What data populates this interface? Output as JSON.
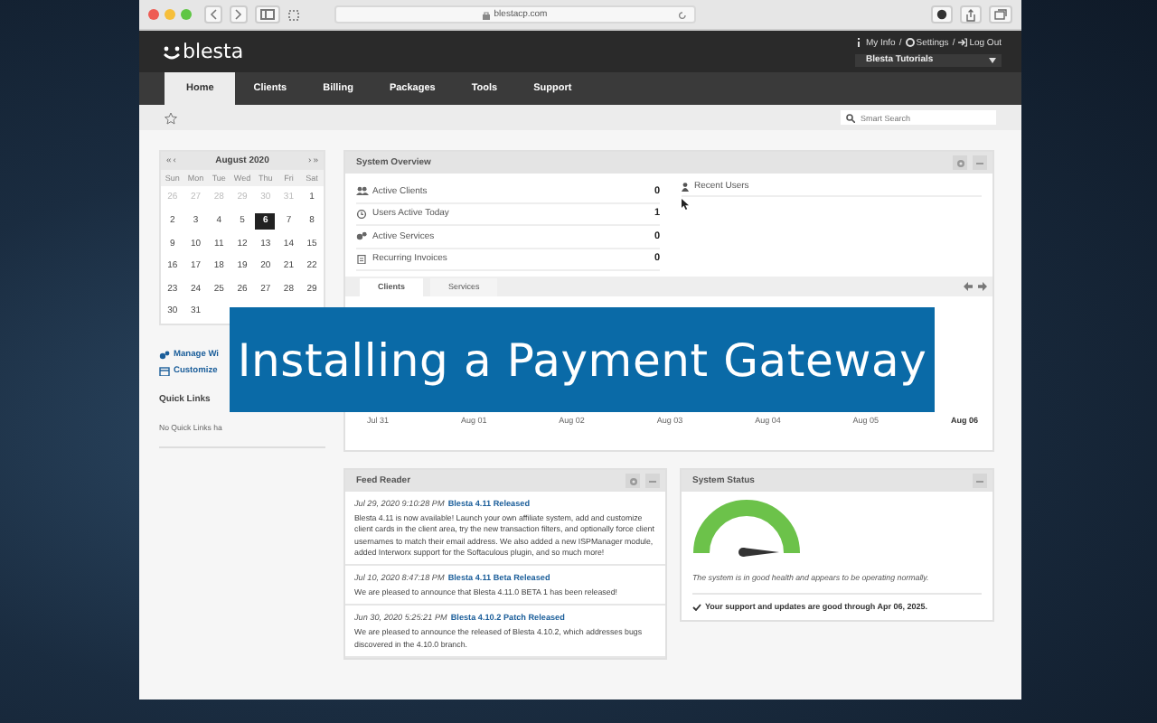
{
  "browser": {
    "url": "blestacp.com"
  },
  "header": {
    "logo": "blesta",
    "user_links": [
      "My Info",
      "Settings",
      "Log Out"
    ],
    "separator": "/",
    "company": "Blesta Tutorials"
  },
  "nav": [
    {
      "label": "Home",
      "selected": true
    },
    {
      "label": "Clients",
      "selected": false
    },
    {
      "label": "Billing",
      "selected": false
    },
    {
      "label": "Packages",
      "selected": false
    },
    {
      "label": "Tools",
      "selected": false
    },
    {
      "label": "Support",
      "selected": false
    }
  ],
  "search": {
    "placeholder": "Smart Search"
  },
  "calendar": {
    "title": "August 2020",
    "prev_year": "«",
    "prev": "‹",
    "next": "›",
    "next_year": "»",
    "weekdays": [
      "Sun",
      "Mon",
      "Tue",
      "Wed",
      "Thu",
      "Fri",
      "Sat"
    ],
    "weeks": [
      [
        {
          "day": "26",
          "muted": true,
          "selected": false
        },
        {
          "day": "27",
          "muted": true,
          "selected": false
        },
        {
          "day": "28",
          "muted": true,
          "selected": false
        },
        {
          "day": "29",
          "muted": true,
          "selected": false
        },
        {
          "day": "30",
          "muted": true,
          "selected": false
        },
        {
          "day": "31",
          "muted": true,
          "selected": false
        },
        {
          "day": "1",
          "muted": false,
          "selected": false
        }
      ],
      [
        {
          "day": "2",
          "muted": false,
          "selected": false
        },
        {
          "day": "3",
          "muted": false,
          "selected": false
        },
        {
          "day": "4",
          "muted": false,
          "selected": false
        },
        {
          "day": "5",
          "muted": false,
          "selected": false
        },
        {
          "day": "6",
          "muted": false,
          "selected": true
        },
        {
          "day": "7",
          "muted": false,
          "selected": false
        },
        {
          "day": "8",
          "muted": false,
          "selected": false
        }
      ],
      [
        {
          "day": "9",
          "muted": false,
          "selected": false
        },
        {
          "day": "10",
          "muted": false,
          "selected": false
        },
        {
          "day": "11",
          "muted": false,
          "selected": false
        },
        {
          "day": "12",
          "muted": false,
          "selected": false
        },
        {
          "day": "13",
          "muted": false,
          "selected": false
        },
        {
          "day": "14",
          "muted": false,
          "selected": false
        },
        {
          "day": "15",
          "muted": false,
          "selected": false
        }
      ],
      [
        {
          "day": "16",
          "muted": false,
          "selected": false
        },
        {
          "day": "17",
          "muted": false,
          "selected": false
        },
        {
          "day": "18",
          "muted": false,
          "selected": false
        },
        {
          "day": "19",
          "muted": false,
          "selected": false
        },
        {
          "day": "20",
          "muted": false,
          "selected": false
        },
        {
          "day": "21",
          "muted": false,
          "selected": false
        },
        {
          "day": "22",
          "muted": false,
          "selected": false
        }
      ],
      [
        {
          "day": "23",
          "muted": false,
          "selected": false
        },
        {
          "day": "24",
          "muted": false,
          "selected": false
        },
        {
          "day": "25",
          "muted": false,
          "selected": false
        },
        {
          "day": "26",
          "muted": false,
          "selected": false
        },
        {
          "day": "27",
          "muted": false,
          "selected": false
        },
        {
          "day": "28",
          "muted": false,
          "selected": false
        },
        {
          "day": "29",
          "muted": false,
          "selected": false
        }
      ],
      [
        {
          "day": "30",
          "muted": false,
          "selected": false
        },
        {
          "day": "31",
          "muted": false,
          "selected": false
        }
      ]
    ]
  },
  "sidebar_links": [
    "Manage Wi",
    "Customize"
  ],
  "quick_links": {
    "title": "Quick Links",
    "text": "No Quick Links ha"
  },
  "system_overview": {
    "title": "System Overview",
    "stats": [
      {
        "label": "Active Clients",
        "value": "0"
      },
      {
        "label": "Users Active Today",
        "value": "1"
      },
      {
        "label": "Active Services",
        "value": "0"
      },
      {
        "label": "Recurring Invoices",
        "value": "0"
      }
    ],
    "recent_users": "Recent Users",
    "tabs": [
      {
        "label": "Clients",
        "selected": true
      },
      {
        "label": "Services",
        "selected": false
      }
    ],
    "axis_labels": [
      {
        "label": "Jul 31",
        "bold": false
      },
      {
        "label": "Aug 01",
        "bold": false
      },
      {
        "label": "Aug 02",
        "bold": false
      },
      {
        "label": "Aug 03",
        "bold": false
      },
      {
        "label": "Aug 04",
        "bold": false
      },
      {
        "label": "Aug 05",
        "bold": false
      },
      {
        "label": "Aug 06",
        "bold": true
      }
    ]
  },
  "feed_reader": {
    "title": "Feed Reader",
    "items": [
      {
        "date": "Jul 29, 2020 9:10:28 PM",
        "title": "Blesta 4.11 Released",
        "body": "Blesta 4.11 is now available! Launch your own affiliate system, add and customize client cards in the client area, try the new transaction filters, and optionally force client usernames to match their email address. We also added a new ISPManager module, added Interworx support for the Softaculous plugin, and so much more!"
      },
      {
        "date": "Jul 10, 2020 8:47:18 PM",
        "title": "Blesta 4.11 Beta Released",
        "body": "We are pleased to announce that Blesta 4.11.0 BETA 1 has been released!"
      },
      {
        "date": "Jun 30, 2020 5:25:21 PM",
        "title": "Blesta 4.10.2 Patch Released",
        "body": "We are pleased to announce the released of Blesta 4.10.2, which addresses bugs discovered in the 4.10.0 branch."
      }
    ]
  },
  "system_status": {
    "title": "System Status",
    "health_text": "The system is in good health and appears to be operating normally.",
    "support_text": "Your support and updates are good through Apr 06, 2025."
  },
  "overlay": {
    "title": "Installing a Payment Gateway"
  }
}
